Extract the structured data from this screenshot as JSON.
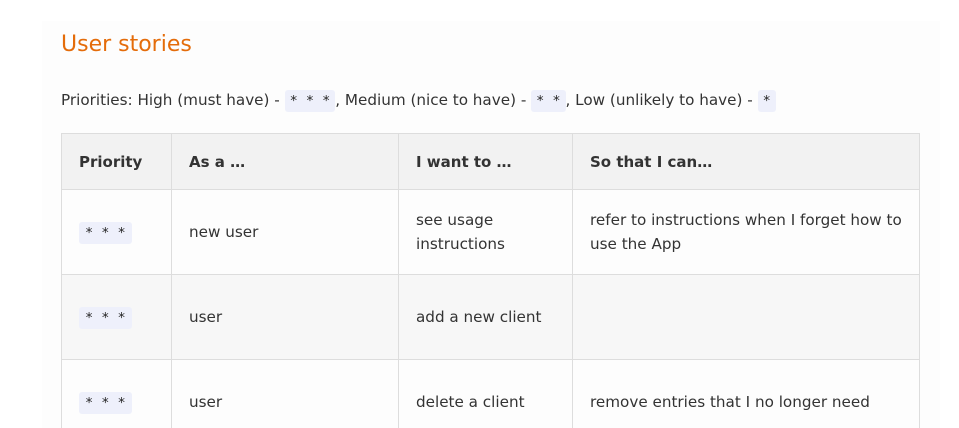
{
  "heading": "User stories",
  "priorities": {
    "lead": "Priorities: High (must have) - ",
    "high_code": "* * *",
    "mid_text": ", Medium (nice to have) - ",
    "medium_code": "* *",
    "low_text": ", Low (unlikely to have) - ",
    "low_code": "*"
  },
  "table": {
    "headers": [
      "Priority",
      "As a …",
      "I want to …",
      "So that I can…"
    ],
    "rows": [
      {
        "priority": "* * *",
        "as_a": "new user",
        "want": "see usage instructions",
        "so_that": "refer to instructions when I forget how to use the App"
      },
      {
        "priority": "* * *",
        "as_a": "user",
        "want": "add a new client",
        "so_that": ""
      },
      {
        "priority": "* * *",
        "as_a": "user",
        "want": "delete a client",
        "so_that": "remove entries that I no longer need"
      }
    ]
  },
  "colors": {
    "heading": "#e46c0a",
    "text": "#333333",
    "code_bg": "#eef0fb",
    "header_bg": "#f2f2f2",
    "border": "#dddddd"
  }
}
